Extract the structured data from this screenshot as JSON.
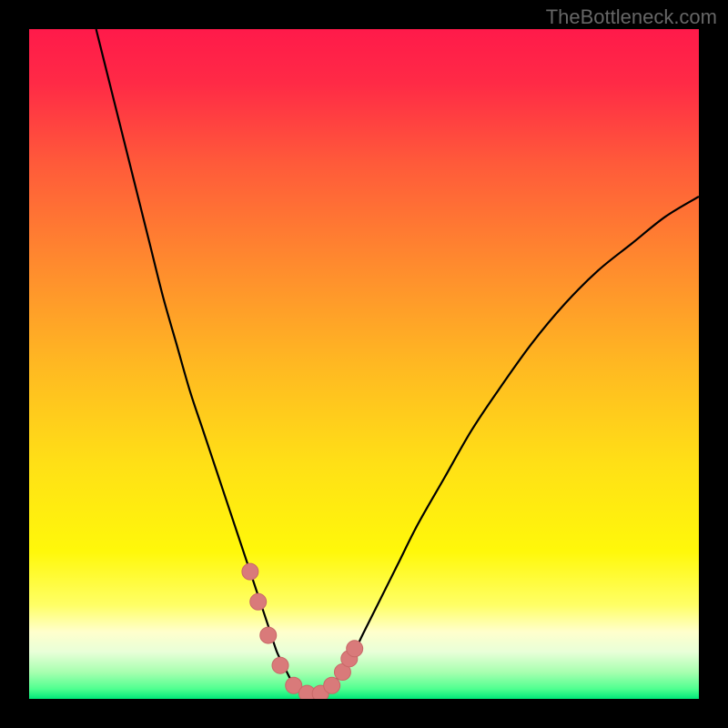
{
  "watermark": "TheBottleneck.com",
  "colors": {
    "bg": "#000000",
    "gradient_stops": [
      {
        "offset": 0.0,
        "color": "#ff1a4a"
      },
      {
        "offset": 0.08,
        "color": "#ff2a46"
      },
      {
        "offset": 0.2,
        "color": "#ff5a3a"
      },
      {
        "offset": 0.35,
        "color": "#ff8a2e"
      },
      {
        "offset": 0.5,
        "color": "#ffb822"
      },
      {
        "offset": 0.65,
        "color": "#ffe016"
      },
      {
        "offset": 0.78,
        "color": "#fff80a"
      },
      {
        "offset": 0.86,
        "color": "#ffff66"
      },
      {
        "offset": 0.9,
        "color": "#ffffcc"
      },
      {
        "offset": 0.93,
        "color": "#e8ffd8"
      },
      {
        "offset": 0.96,
        "color": "#a8ffb0"
      },
      {
        "offset": 0.985,
        "color": "#50ff90"
      },
      {
        "offset": 1.0,
        "color": "#00e878"
      }
    ],
    "curve": "#000000",
    "marker_fill": "#d97a7a",
    "marker_stroke": "#c86868"
  },
  "chart_data": {
    "type": "line",
    "title": "",
    "xlabel": "",
    "ylabel": "",
    "xlim": [
      0,
      100
    ],
    "ylim": [
      0,
      100
    ],
    "series": [
      {
        "name": "bottleneck-curve",
        "x": [
          10,
          12,
          14,
          16,
          18,
          20,
          22,
          24,
          26,
          28,
          30,
          31,
          32,
          33,
          34,
          35,
          36,
          37,
          38,
          39,
          40,
          41,
          42,
          43,
          44,
          45,
          46,
          48,
          50,
          52,
          55,
          58,
          62,
          66,
          70,
          75,
          80,
          85,
          90,
          95,
          100
        ],
        "y": [
          100,
          92,
          84,
          76,
          68,
          60,
          53,
          46,
          40,
          34,
          28,
          25,
          22,
          19,
          16,
          13,
          10,
          7,
          5,
          3,
          1.5,
          0.8,
          0.5,
          0.5,
          0.8,
          1.5,
          3,
          6,
          10,
          14,
          20,
          26,
          33,
          40,
          46,
          53,
          59,
          64,
          68,
          72,
          75
        ]
      }
    ],
    "markers": {
      "name": "highlight-points",
      "x": [
        33.0,
        34.2,
        35.7,
        37.5,
        39.5,
        41.5,
        43.5,
        45.2,
        46.8,
        47.8,
        48.6
      ],
      "y": [
        19.0,
        14.5,
        9.5,
        5.0,
        2.0,
        0.8,
        0.8,
        2.0,
        4.0,
        6.0,
        7.5
      ]
    }
  }
}
